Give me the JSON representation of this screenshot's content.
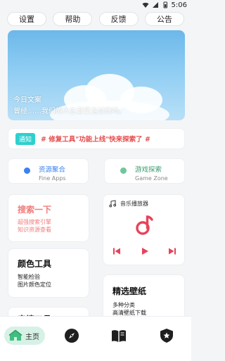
{
  "status": {
    "time": "5:06",
    "icons": [
      "wifi-icon",
      "signal-icon",
      "battery-icon"
    ]
  },
  "topnav": {
    "items": [
      "设置",
      "帮助",
      "反馈",
      "公告"
    ]
  },
  "banner": {
    "title": "今日文案",
    "subtitle": "曾经……我们的人生都是走过的吗。"
  },
  "notice": {
    "tag": "通知",
    "text": "# 修复工具\"功能上线\"快来探索了 #"
  },
  "quick": [
    {
      "title": "资源聚合",
      "subtitle": "Fine Apps",
      "color": "#3a82f0",
      "title_color": "#3a82f0"
    },
    {
      "title": "游戏探索",
      "subtitle": "Game Zone",
      "color": "#6fc79a",
      "title_color": "#3a9b6e"
    }
  ],
  "cards": {
    "search": {
      "title": "搜索一下",
      "lines": [
        "超强搜索引擎",
        "知识资源查看"
      ],
      "color": "#f27b7b"
    },
    "color": {
      "title": "颜色工具",
      "lines": [
        "智能检验",
        "图片颜色定位"
      ]
    },
    "wallpaper": {
      "title": "精选壁纸",
      "lines": [
        "多种分类",
        "高清壁纸下载"
      ]
    },
    "partial": {
      "title": "表情工具"
    }
  },
  "player": {
    "title": "音乐播放器",
    "accent": "#e8425a"
  },
  "tabbar": {
    "home_label": "主页",
    "icons": [
      "home-icon",
      "compass-icon",
      "book-icon",
      "shield-icon"
    ],
    "accent": "#3fbf7f"
  }
}
